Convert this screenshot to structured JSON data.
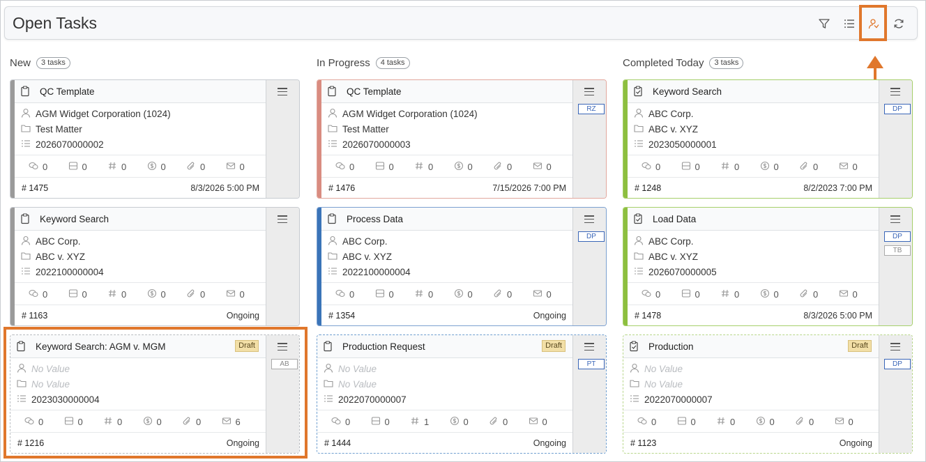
{
  "header": {
    "title": "Open Tasks"
  },
  "toolbar": [
    "filter-icon",
    "list-icon",
    "assignee-icon",
    "refresh-icon"
  ],
  "colors": {
    "accent": "#e0772c",
    "red": "#d98c80",
    "blue": "#3a74b8",
    "green": "#8dbf3f",
    "gray": "#9a9a9a"
  },
  "columns": [
    {
      "name": "New",
      "badge": "3 tasks"
    },
    {
      "name": "In Progress",
      "badge": "4 tasks"
    },
    {
      "name": "Completed Today",
      "badge": "3 tasks"
    }
  ],
  "cards": [
    {
      "title": "QC Template",
      "client": "AGM Widget Corporation (1024)",
      "matter": "Test Matter",
      "number": "2026070000002",
      "counts": [
        "0",
        "0",
        "0",
        "0",
        "0",
        "0"
      ],
      "id": "# 1475",
      "when": "8/3/2026 5:00 PM",
      "tags": []
    },
    {
      "title": "QC Template",
      "client": "AGM Widget Corporation (1024)",
      "matter": "Test Matter",
      "number": "2026070000003",
      "counts": [
        "0",
        "0",
        "0",
        "0",
        "0",
        "0"
      ],
      "id": "# 1476",
      "when": "7/15/2026 7:00 PM",
      "tags": [
        "RZ"
      ]
    },
    {
      "title": "Keyword Search",
      "client": "ABC Corp.",
      "matter": "ABC v. XYZ",
      "number": "2023050000001",
      "counts": [
        "0",
        "0",
        "0",
        "0",
        "0",
        "0"
      ],
      "id": "# 1248",
      "when": "8/2/2023 7:00 PM",
      "tags": [
        "DP"
      ]
    },
    {
      "title": "Keyword Search",
      "client": "ABC Corp.",
      "matter": "ABC v. XYZ",
      "number": "2022100000004",
      "counts": [
        "0",
        "0",
        "0",
        "0",
        "0",
        "0"
      ],
      "id": "# 1163",
      "when": "Ongoing",
      "tags": []
    },
    {
      "title": "Process Data",
      "client": "ABC Corp.",
      "matter": "ABC v. XYZ",
      "number": "2022100000004",
      "counts": [
        "0",
        "0",
        "0",
        "0",
        "0",
        "0"
      ],
      "id": "# 1354",
      "when": "Ongoing",
      "tags": [
        "DP"
      ]
    },
    {
      "title": "Load Data",
      "client": "ABC Corp.",
      "matter": "ABC v. XYZ",
      "number": "2026070000005",
      "counts": [
        "0",
        "0",
        "0",
        "0",
        "0",
        "0"
      ],
      "id": "# 1478",
      "when": "8/3/2026 5:00 PM",
      "tags": [
        "DP",
        "TB"
      ]
    },
    {
      "title": "Keyword Search: AGM v. MGM",
      "draft": "Draft",
      "client": "No Value",
      "matter": "No Value",
      "number": "2023030000004",
      "counts": [
        "0",
        "0",
        "0",
        "0",
        "0",
        "6"
      ],
      "id": "# 1216",
      "when": "Ongoing",
      "tags": [
        "AB"
      ]
    },
    {
      "title": "Production Request",
      "draft": "Draft",
      "client": "No Value",
      "matter": "No Value",
      "number": "2022070000007",
      "counts": [
        "0",
        "0",
        "1",
        "0",
        "0",
        "0"
      ],
      "id": "# 1444",
      "when": "Ongoing",
      "tags": [
        "PT"
      ]
    },
    {
      "title": "Production",
      "draft": "Draft",
      "client": "No Value",
      "matter": "No Value",
      "number": "2022070000007",
      "counts": [
        "0",
        "0",
        "0",
        "0",
        "0",
        "0"
      ],
      "id": "# 1123",
      "when": "Ongoing",
      "tags": [
        "DP"
      ]
    }
  ]
}
